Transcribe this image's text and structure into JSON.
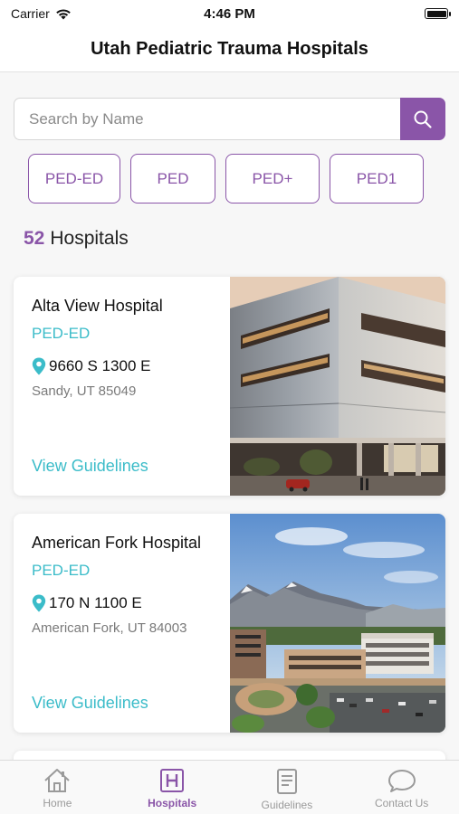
{
  "status_bar": {
    "carrier": "Carrier",
    "time": "4:46 PM"
  },
  "header": {
    "title": "Utah Pediatric Trauma Hospitals"
  },
  "search": {
    "placeholder": "Search by Name",
    "value": ""
  },
  "filters": [
    "PED-ED",
    "PED",
    "PED+",
    "PED1"
  ],
  "results": {
    "count": "52",
    "label": "Hospitals"
  },
  "hospitals": [
    {
      "name": "Alta View Hospital",
      "level": "PED-ED",
      "address": "9660 S 1300 E",
      "city": "Sandy, UT 85049",
      "link": "View Guidelines"
    },
    {
      "name": "American Fork Hospital",
      "level": "PED-ED",
      "address": "170 N 1100 E",
      "city": "American Fork, UT 84003",
      "link": "View Guidelines"
    }
  ],
  "tab_bar": {
    "active": "Hospitals",
    "tabs": [
      {
        "label": "Home",
        "icon": "home-icon"
      },
      {
        "label": "Hospitals",
        "icon": "hospital-icon"
      },
      {
        "label": "Guidelines",
        "icon": "document-icon"
      },
      {
        "label": "Contact Us",
        "icon": "chat-bubble-icon"
      }
    ]
  },
  "colors": {
    "accent": "#8a55a8",
    "teal": "#3bbcc9",
    "text": "#222222",
    "muted": "#7a7a7a"
  }
}
